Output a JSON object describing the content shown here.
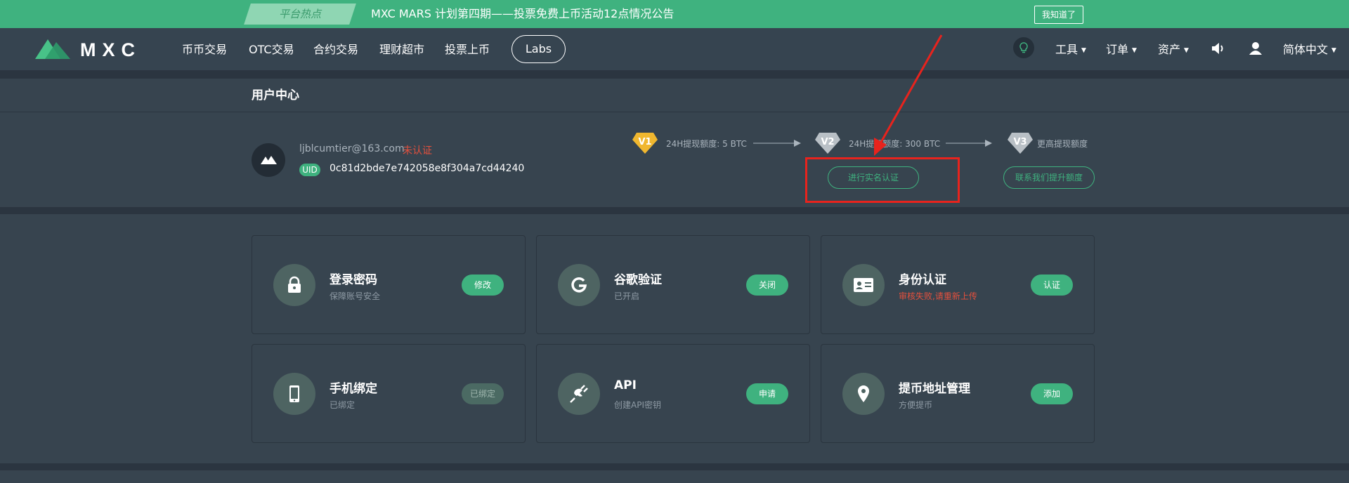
{
  "announcement": {
    "tag": "平台热点",
    "text": "MXC MARS 计划第四期——投票免费上币活动12点情况公告",
    "dismiss_label": "我知道了"
  },
  "nav": {
    "logo_text": "MXC",
    "items": [
      "币币交易",
      "OTC交易",
      "合约交易",
      "理财超市",
      "投票上币"
    ],
    "labs": "Labs",
    "right": {
      "tools": "工具",
      "orders": "订单",
      "assets": "资产",
      "language": "简体中文"
    },
    "icons": [
      "lightbulb-icon",
      "speaker-icon",
      "user-icon"
    ]
  },
  "user_center": {
    "title": "用户中心",
    "email": "ljblcumtier@163.com",
    "status": "未认证",
    "uid_label": "UID",
    "uid": "0c81d2bde7e742058e8f304a7cd44240",
    "levels": [
      {
        "badge": "V1",
        "text": "24H提现额度: 5 BTC",
        "color": "#f0b72f"
      },
      {
        "badge": "V2",
        "text": "24H提现额度: 300 BTC",
        "color": "#b9c0c6"
      },
      {
        "badge": "V3",
        "text": "更高提现额度",
        "color": "#b9c0c6"
      }
    ],
    "verify_button": "进行实名认证",
    "contact_button": "联系我们提升额度"
  },
  "security_cards": [
    {
      "icon": "lock-icon",
      "title": "登录密码",
      "subtitle": "保障账号安全",
      "subtitle_warning": false,
      "button": "修改",
      "button_enabled": true
    },
    {
      "icon": "google-icon",
      "title": "谷歌验证",
      "subtitle": "已开启",
      "subtitle_warning": false,
      "button": "关闭",
      "button_enabled": true
    },
    {
      "icon": "id-card-icon",
      "title": "身份认证",
      "subtitle": "审核失败,请重新上传",
      "subtitle_warning": true,
      "button": "认证",
      "button_enabled": true
    },
    {
      "icon": "phone-icon",
      "title": "手机绑定",
      "subtitle": "已绑定",
      "subtitle_warning": false,
      "button": "已绑定",
      "button_enabled": false
    },
    {
      "icon": "plug-icon",
      "title": "API",
      "subtitle": "创建API密钥",
      "subtitle_warning": false,
      "button": "申请",
      "button_enabled": true
    },
    {
      "icon": "location-pin-icon",
      "title": "提币地址管理",
      "subtitle": "方便提币",
      "subtitle_warning": false,
      "button": "添加",
      "button_enabled": true
    }
  ],
  "colors": {
    "brand_green": "#3fb27f",
    "warning_red": "#e4503d",
    "annotation_red": "#e8231d"
  }
}
